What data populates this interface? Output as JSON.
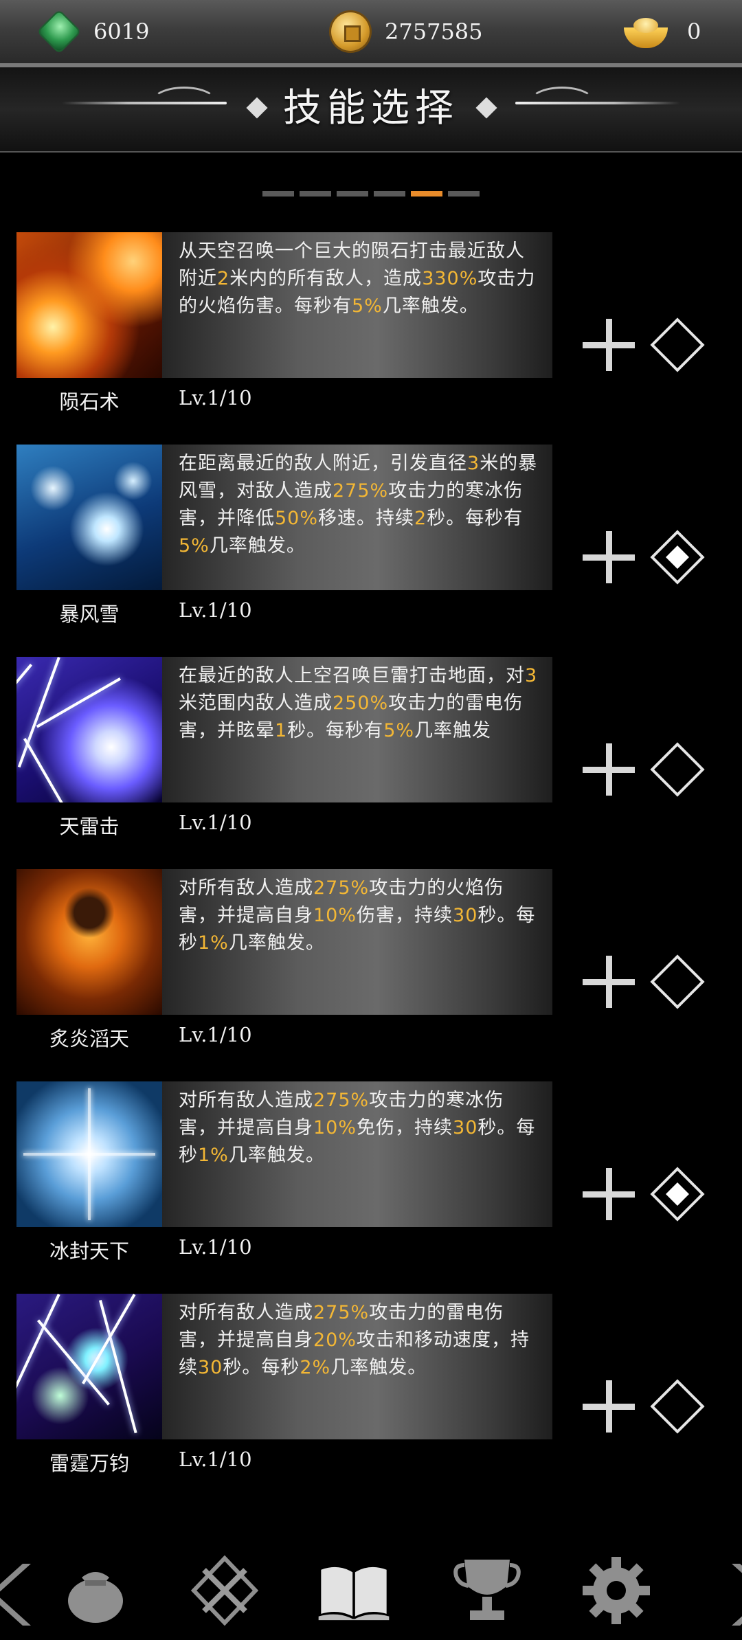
{
  "currency": {
    "gems": "6019",
    "coins": "2757585",
    "ingots": "0"
  },
  "header": {
    "title": "技能选择"
  },
  "pagination": {
    "total": 6,
    "active_index": 4
  },
  "skills": [
    {
      "name": "陨石术",
      "level": "Lv.1/10",
      "desc": [
        "从天空召唤一个巨大的陨石打击最近敌人附近",
        "2",
        "米内的所有敌人，造成",
        "330%",
        "攻击力的火焰伤害。每秒有",
        "5%",
        "几率触发。"
      ],
      "selected": false,
      "icon": "meteor-art"
    },
    {
      "name": "暴风雪",
      "level": "Lv.1/10",
      "desc": [
        "在距离最近的敌人附近，引发直径",
        "3",
        "米的暴风雪，对敌人造成",
        "275%",
        "攻击力的寒冰伤害，并降低",
        "50%",
        "移速。持续",
        "2",
        "秒。每秒有",
        "5%",
        "几率触发。"
      ],
      "selected": true,
      "icon": "blizzard-art"
    },
    {
      "name": "天雷击",
      "level": "Lv.1/10",
      "desc": [
        "在最近的敌人上空召唤巨雷打击地面，对",
        "3",
        "米范围内敌人造成",
        "250%",
        "攻击力的雷电伤害，并眩晕",
        "1",
        "秒。每秒有",
        "5%",
        "几率触发"
      ],
      "selected": false,
      "icon": "thunder-art"
    },
    {
      "name": "炙炎滔天",
      "level": "Lv.1/10",
      "desc": [
        "对所有敌人造成",
        "275%",
        "攻击力的火焰伤害，并提高自身",
        "10%",
        "伤害，持续",
        "30",
        "秒。每秒",
        "1%",
        "几率触发。"
      ],
      "selected": false,
      "icon": "inferno-art"
    },
    {
      "name": "冰封天下",
      "level": "Lv.1/10",
      "desc": [
        "对所有敌人造成",
        "275%",
        "攻击力的寒冰伤害，并提高自身",
        "10%",
        "免伤，持续",
        "30",
        "秒。每秒",
        "1%",
        "几率触发。"
      ],
      "selected": true,
      "icon": "frost-art"
    },
    {
      "name": "雷霆万钧",
      "level": "Lv.1/10",
      "desc": [
        "对所有敌人造成",
        "275%",
        "攻击力的雷电伤害，并提高自身",
        "20%",
        "攻击和移动速度，持续",
        "30",
        "秒。每秒",
        "2%",
        "几率触发。"
      ],
      "selected": false,
      "icon": "storm-art"
    }
  ],
  "nav": [
    "bag-icon",
    "crossed-swords-icon",
    "book-icon",
    "trophy-icon",
    "gear-icon"
  ],
  "colors": {
    "accent": "#e88b2a",
    "highlight": "#f3b735"
  }
}
